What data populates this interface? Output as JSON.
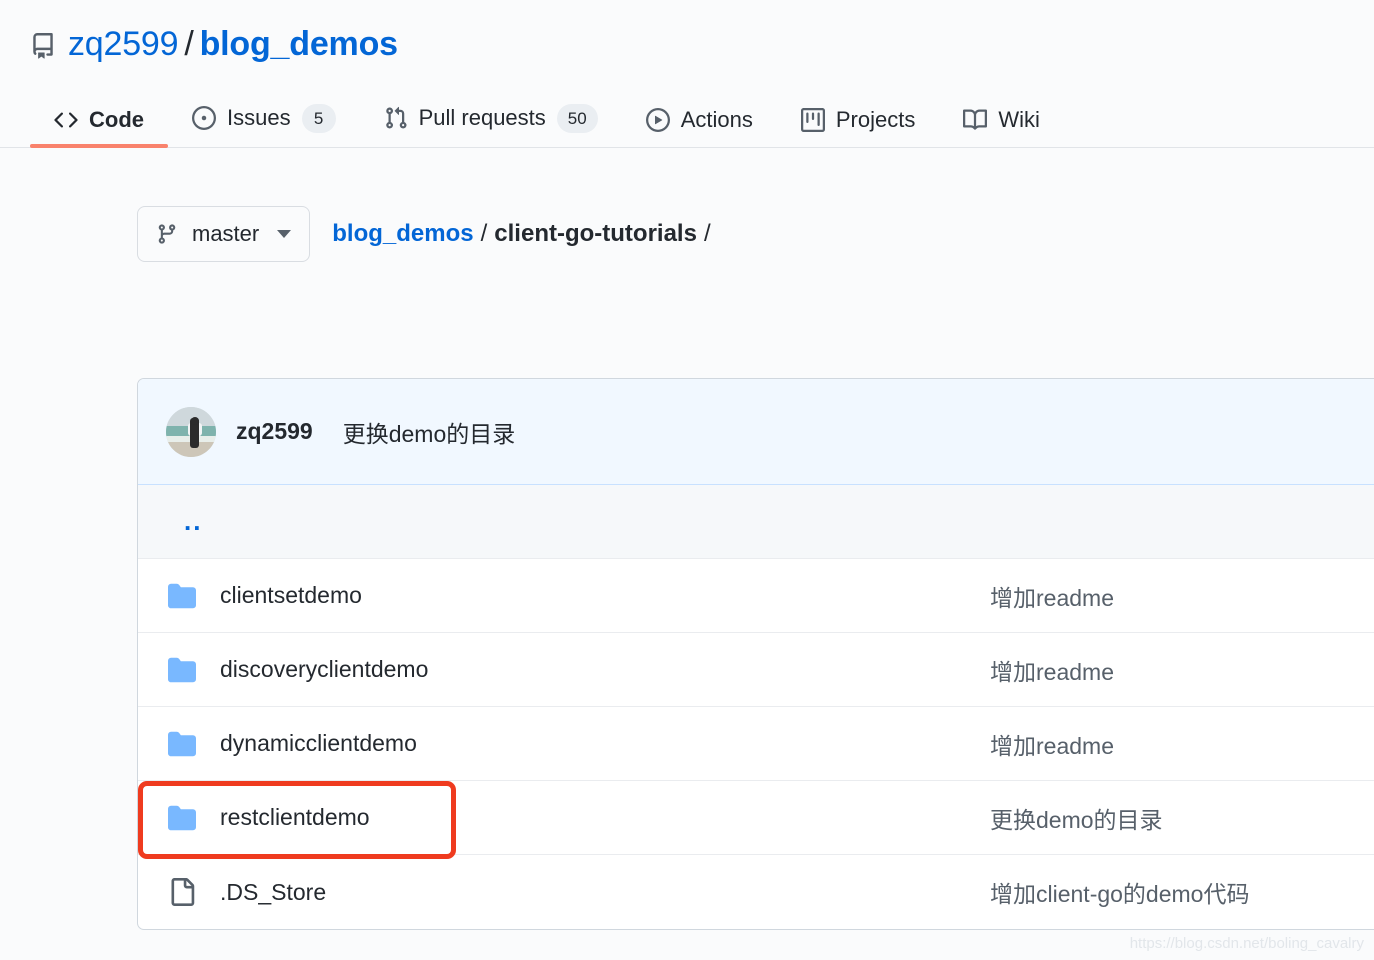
{
  "repo": {
    "icon": "repo-icon",
    "owner": "zq2599",
    "separator": "/",
    "name": "blog_demos"
  },
  "nav": {
    "tabs": [
      {
        "label": "Code",
        "icon": "code-icon",
        "count": null,
        "active": true
      },
      {
        "label": "Issues",
        "icon": "issue-opened-icon",
        "count": "5",
        "active": false
      },
      {
        "label": "Pull requests",
        "icon": "git-pull-request-icon",
        "count": "50",
        "active": false
      },
      {
        "label": "Actions",
        "icon": "play-icon",
        "count": null,
        "active": false
      },
      {
        "label": "Projects",
        "icon": "project-icon",
        "count": null,
        "active": false
      },
      {
        "label": "Wiki",
        "icon": "book-icon",
        "count": null,
        "active": false
      }
    ],
    "active_underline_color": "#f9826c"
  },
  "branch": {
    "icon": "git-branch-icon",
    "name": "master",
    "caret": "chevron-down-icon"
  },
  "breadcrumb": {
    "root": "blog_demos",
    "sep1": "/",
    "current": "client-go-tutorials",
    "sep2": "/"
  },
  "commit_header": {
    "author": "zq2599",
    "message": "更换demo的目录",
    "avatar": "avatar"
  },
  "files": {
    "up_dir_label": "..",
    "rows": [
      {
        "icon": "folder-icon",
        "name": "clientsetdemo",
        "commit": "增加readme"
      },
      {
        "icon": "folder-icon",
        "name": "discoveryclientdemo",
        "commit": "增加readme"
      },
      {
        "icon": "folder-icon",
        "name": "dynamicclientdemo",
        "commit": "增加readme"
      },
      {
        "icon": "folder-icon",
        "name": "restclientdemo",
        "commit": "更换demo的目录"
      },
      {
        "icon": "file-icon",
        "name": ".DS_Store",
        "commit": "增加client-go的demo代码"
      }
    ]
  },
  "annotation": {
    "target": "restclientdemo",
    "color": "#ef3b1f"
  },
  "watermark": {
    "text": "https://blog.csdn.net/boling_cavalry"
  }
}
